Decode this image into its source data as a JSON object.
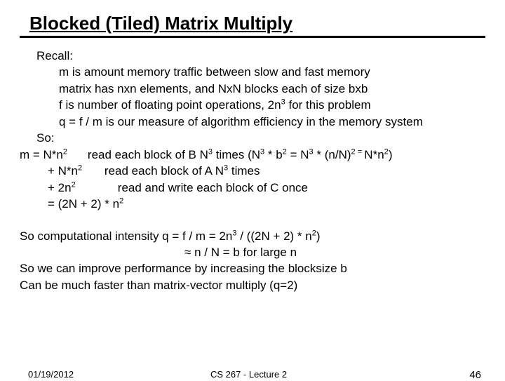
{
  "title": "Blocked (Tiled) Matrix Multiply",
  "recall": {
    "heading": "Recall:",
    "m": "m is amount memory traffic between slow and fast memory",
    "matrix": "matrix has nxn elements, and NxN blocks each of size bxb",
    "f_pre": "f is number of floating point operations, 2n",
    "f_exp": "3",
    "f_post": " for this problem",
    "q": "q = f / m is our measure of algorithm efficiency in the memory system"
  },
  "so": {
    "heading": "So:",
    "m_lhs": "m =  N*n",
    "m_exp1": "2",
    "m_desc_pre": "read each block of B  N",
    "m_desc_exp": "3",
    "m_desc_mid1": " times (N",
    "m_desc_mid2": " * b",
    "m_desc_mid3": " = N",
    "m_desc_mid4": " * (n/N)",
    "m_desc_eq": " = ",
    "m_desc_end": "N*n",
    "m_desc_close": ")",
    "l2_lhs": "+ N*n",
    "l2_desc_pre": "read each block of A  N",
    "l2_desc_post": " times",
    "l3_lhs": "+ 2n",
    "l3_desc": "read and write each block of C once",
    "l4_pre": "=  (2N + 2) * n",
    "l4_exp": "2"
  },
  "intensity": {
    "line1_pre": "So computational intensity q = f / m = 2n",
    "line1_exp": "3",
    "line1_mid": " / ((2N + 2) * n",
    "line1_exp2": "2",
    "line1_post": ")",
    "line2": " n / N = b   for large n",
    "line3": "So we can improve performance by increasing the blocksize b",
    "line4": "Can be much faster than matrix-vector multiply (q=2)"
  },
  "footer": {
    "date": "01/19/2012",
    "course": "CS 267 - Lecture 2",
    "page": "46"
  }
}
